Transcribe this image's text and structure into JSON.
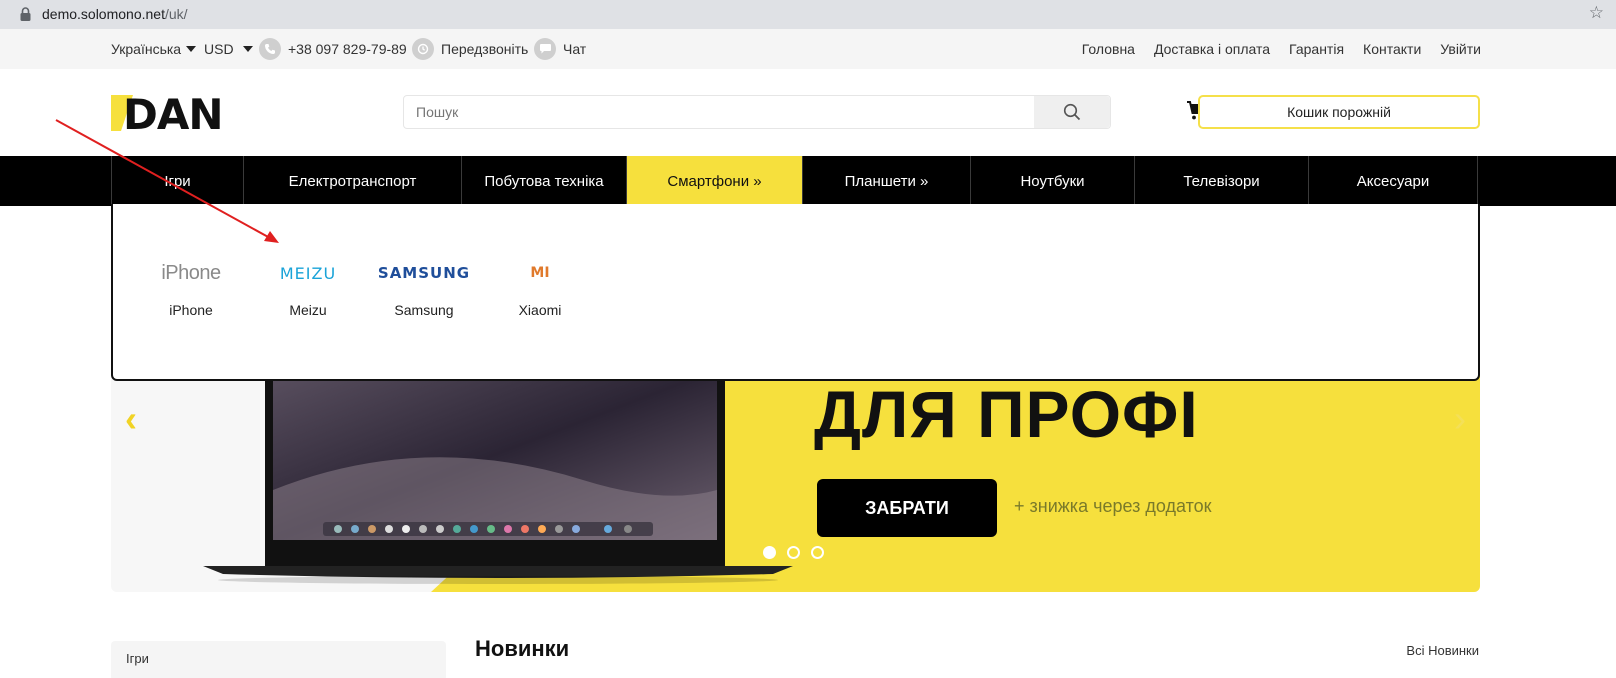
{
  "browser": {
    "url_host": "demo.solomono.net",
    "url_path": "/uk/"
  },
  "topbar": {
    "language": "Українська",
    "currency": "USD",
    "phone": "+38 097 829-79-89",
    "callback": "Передзвоніть",
    "chat": "Чат",
    "links": [
      "Головна",
      "Доставка і оплата",
      "Гарантія",
      "Контакти",
      "Увійти"
    ]
  },
  "header": {
    "logo_text": "DAN",
    "search_placeholder": "Пошук",
    "cart_label": "Кошик порожній"
  },
  "nav": {
    "items": [
      {
        "label": "Ігри"
      },
      {
        "label": "Електротранспорт"
      },
      {
        "label": "Побутова техніка"
      },
      {
        "label": "Смартфони »",
        "active": true
      },
      {
        "label": "Планшети »"
      },
      {
        "label": "Ноутбуки"
      },
      {
        "label": "Телевізори"
      },
      {
        "label": "Аксесуари"
      }
    ]
  },
  "dropdown": {
    "brands": [
      {
        "label": "iPhone",
        "logo_text": "iPhone",
        "color": "#888888"
      },
      {
        "label": "Meizu",
        "logo_text": "MEIZU",
        "color": "#1aa3d8"
      },
      {
        "label": "Samsung",
        "logo_text": "SAMSUNG",
        "color": "#1f4e9a"
      },
      {
        "label": "Xiaomi",
        "logo_text": "MI",
        "color": "#e07a2c"
      }
    ]
  },
  "banner": {
    "title": "ДЛЯ ПРОФІ",
    "cta": "ЗАБРАТИ",
    "note": "+ знижка через додаток",
    "slides_total": 3,
    "active_slide": 1
  },
  "sidebar": {
    "first_item": "Ігри"
  },
  "section": {
    "title": "Новинки",
    "all_link": "Всі Новинки"
  },
  "colors": {
    "accent_yellow": "#f6e03d",
    "nav_black": "#000000",
    "annotation_red": "#e02020"
  }
}
